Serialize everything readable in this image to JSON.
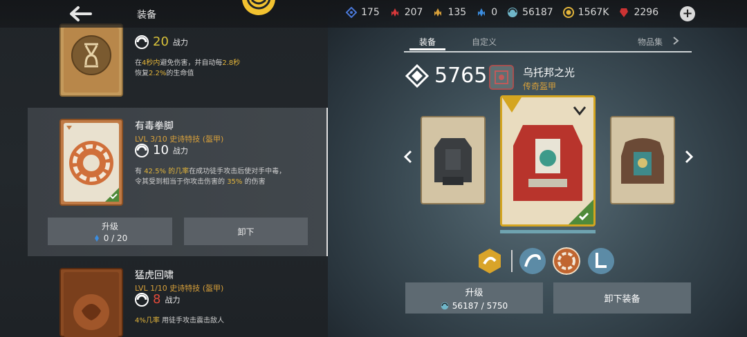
{
  "header": {
    "title": "装备",
    "resources": [
      {
        "icon": "blue-crystal-icon",
        "value": "175",
        "color": "#4a78d8"
      },
      {
        "icon": "red-shard-icon",
        "value": "207",
        "color": "#d8383a"
      },
      {
        "icon": "gold-shard-icon",
        "value": "135",
        "color": "#d9a13a"
      },
      {
        "icon": "blue-shard-icon",
        "value": "0",
        "color": "#3b8de0"
      },
      {
        "icon": "orb-icon",
        "value": "56187",
        "color": "#6fb6c9"
      },
      {
        "icon": "coin-icon",
        "value": "1567K",
        "color": "#e3b53b"
      },
      {
        "icon": "ruby-icon",
        "value": "2296",
        "color": "#cc3333"
      }
    ]
  },
  "items": [
    {
      "power": "20",
      "power_label": "战力",
      "desc_line1": [
        "在",
        "4秒内",
        "避免伤害，并自动每",
        "2.8秒"
      ],
      "desc_line2": [
        "恢复",
        "2.2%",
        "的生命值"
      ]
    },
    {
      "name": "有毒拳脚",
      "meta": "LVL  3/10  史诗特技 (盔甲)",
      "power": "10",
      "power_label": "战力",
      "desc_line1": [
        "有 ",
        "42.5% 的几率",
        "在成功徒手攻击后使对手中毒，"
      ],
      "desc_line2": [
        "令其受到相当于你攻击伤害的 ",
        "35%",
        " 的伤害"
      ],
      "upgrade_label": "升级",
      "upgrade_cost": "0 / 20",
      "unequip_label": "卸下"
    },
    {
      "name": "猛虎回啸",
      "meta": "LVL  1/10  史诗特技 (盔甲)",
      "power": "8",
      "power_label": "战力",
      "desc_line1": [
        "4%几率",
        " 用徒手攻击震击敌人"
      ]
    }
  ],
  "right": {
    "tabs": [
      "装备",
      "自定义",
      "物品集"
    ],
    "power": "5765",
    "armor_name": "乌托邦之光",
    "armor_rarity": "传奇盔甲",
    "upgrade_label": "升级",
    "upgrade_cost": "56187 / 5750",
    "unequip_label": "卸下装备"
  }
}
